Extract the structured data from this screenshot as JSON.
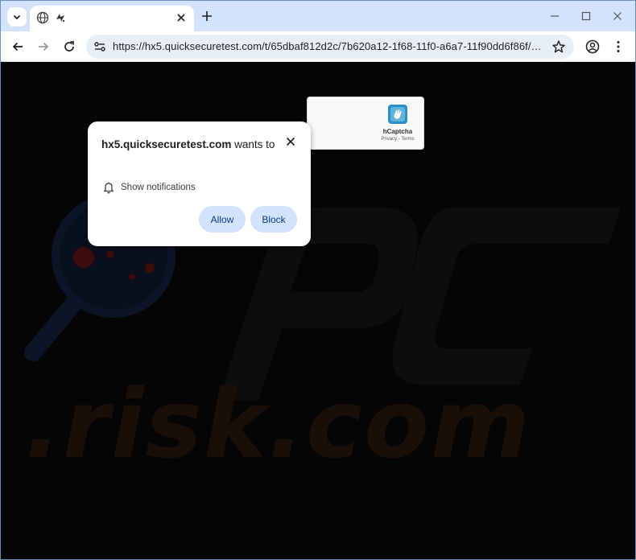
{
  "browser": {
    "url": "https://hx5.quicksecuretest.com/t/65dbaf812d2c/7b620a12-1f68-11f0-a6a7-11f90dd6f86f/7b7f24..."
  },
  "captcha": {
    "name": "hCaptcha",
    "links": "Privacy - Terms"
  },
  "popup": {
    "site": "hx5.quicksecuretest.com",
    "title_suffix": " wants to",
    "permission_label": "Show notifications",
    "allow_label": "Allow",
    "block_label": "Block"
  },
  "watermark": {
    "text": ".risk.com"
  },
  "colors": {
    "tabstrip": "#d3e3fd",
    "omnibox": "#e8eef8",
    "popup_button": "#d3e3fd",
    "popup_button_text": "#0b3a8a"
  },
  "icons": {
    "tab_search": "chevron-down-icon",
    "favicon": "globe-icon",
    "tab_close": "close-icon",
    "new_tab": "plus-icon",
    "back": "arrow-left-icon",
    "forward": "arrow-right-icon",
    "reload": "reload-icon",
    "site_info": "tune-icon",
    "bookmark": "star-icon",
    "profile": "profile-icon",
    "menu": "kebab-menu-icon",
    "permission": "bell-icon"
  }
}
